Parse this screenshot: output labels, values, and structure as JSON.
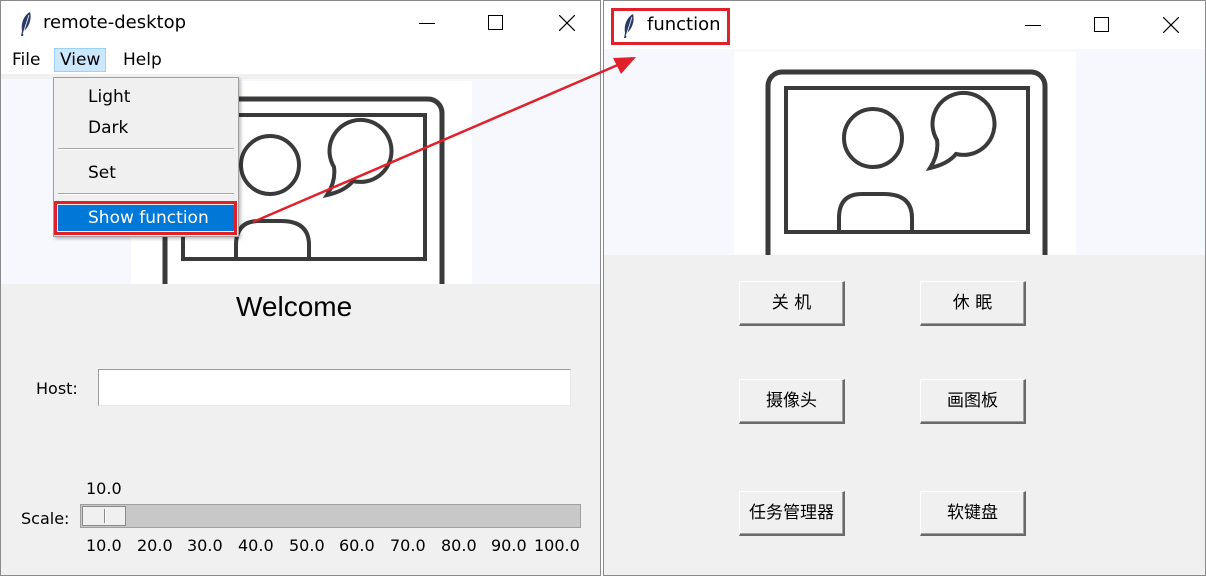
{
  "remote_desktop_window": {
    "title": "remote-desktop",
    "menu": [
      "File",
      "View",
      "Help"
    ],
    "view_menu": {
      "items": [
        "Light",
        "Dark",
        "Set",
        "Show function"
      ],
      "highlighted": "Show function"
    },
    "welcome_text": "Welcome",
    "host_label": "Host:",
    "host_value": "",
    "scale": {
      "label": "Scale:",
      "current_value": "10.0",
      "value": 10.0,
      "min": 10.0,
      "max": 100.0,
      "ticks": [
        "10.0",
        "20.0",
        "30.0",
        "40.0",
        "50.0",
        "60.0",
        "70.0",
        "80.0",
        "90.0",
        "100.0"
      ]
    }
  },
  "function_window": {
    "title": "function",
    "buttons": [
      "关 机",
      "休 眠",
      "摄像头",
      "画图板",
      "任务管理器",
      "软键盘"
    ]
  },
  "icons": [
    "feather-icon",
    "minimize-icon",
    "maximize-icon",
    "close-icon",
    "video-chat-icon"
  ],
  "colors": {
    "menu_highlight": "#0078d7",
    "annotation_red": "#e0202a",
    "menu_open_bg": "#cce8ff"
  }
}
